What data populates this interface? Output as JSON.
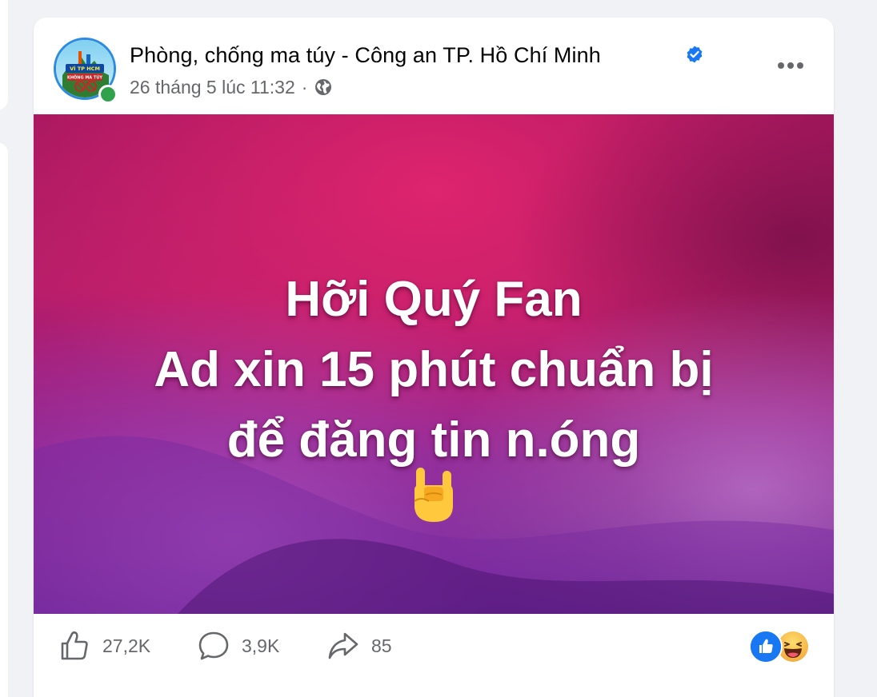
{
  "post": {
    "author": "Phòng, chống ma túy - Công an TP. Hồ Chí Minh",
    "verified": true,
    "timestamp": "26 tháng 5 lúc 11:32",
    "separator": "·",
    "audience_icon": "globe-icon",
    "avatar_text_top": "VÌ TP HCM",
    "avatar_text_bottom": "KHÔNG MA TÚY",
    "more_icon": "more-horizontal-icon"
  },
  "image": {
    "lines": [
      "Hỡi Quý Fan",
      "Ad xin 15 phút chuẩn bị",
      "để đăng tin n.óng"
    ],
    "emoji": "rock-on-hand-emoji",
    "colors": {
      "top": "#c2185b",
      "mid": "#8e1d8f",
      "bottom": "#6a1b9a"
    }
  },
  "stats": {
    "likes": "27,2K",
    "comments": "3,9K",
    "shares": "85",
    "reactions": [
      "like-reaction-icon",
      "haha-reaction-icon"
    ]
  },
  "colors": {
    "accent": "#1877f2",
    "verified": "#1877f2",
    "online": "#31a24c",
    "secondary_text": "#65676b"
  }
}
